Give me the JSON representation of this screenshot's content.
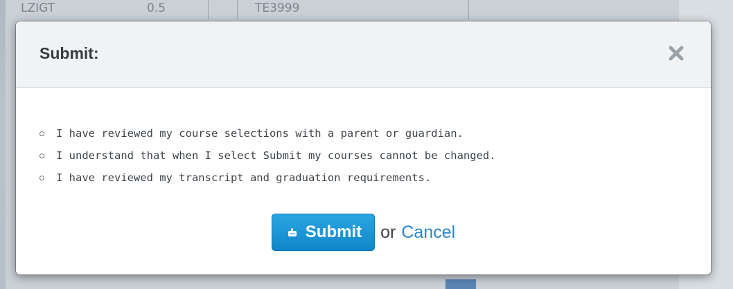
{
  "background": {
    "row_cells": [
      "LZIGT",
      "0.5",
      "TE3999"
    ]
  },
  "dialog": {
    "title": "Submit:",
    "close_icon": "close-x-icon",
    "checklist": [
      "I have reviewed my course selections with a parent or guardian.",
      "I understand that when I select Submit my courses cannot be changed.",
      "I have reviewed my transcript and graduation requirements."
    ],
    "submit_label": "Submit",
    "submit_icon": "hand-pointer-icon",
    "or_text": "or",
    "cancel_label": "Cancel"
  },
  "colors": {
    "primary_button": "#1a93d6",
    "link": "#2a86c4",
    "header_bg": "#f0f2f3",
    "overlay": "#b9c3cc"
  }
}
